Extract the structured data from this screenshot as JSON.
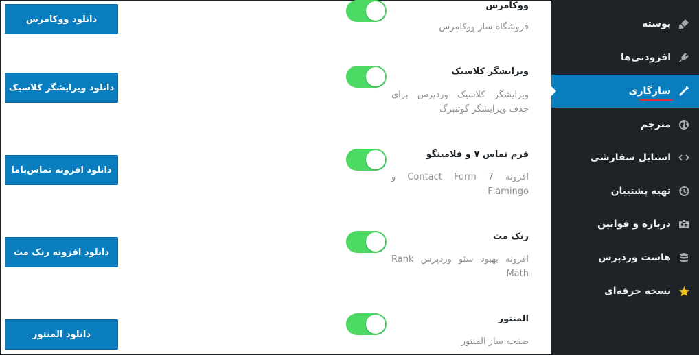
{
  "sidebar": {
    "items": [
      {
        "label": "پوسته",
        "icon": "brush-icon"
      },
      {
        "label": "افزودنی‌ها",
        "icon": "plugin-icon"
      },
      {
        "label": "سازگاری",
        "icon": "wrench-icon",
        "active": true
      },
      {
        "label": "مترجم",
        "icon": "globe-icon"
      },
      {
        "label": "استایل سفارشی",
        "icon": "code-icon"
      },
      {
        "label": "تهیه پشتیبان",
        "icon": "history-icon"
      },
      {
        "label": "درباره و قوانین",
        "icon": "id-card-icon"
      },
      {
        "label": "هاست وردپرس",
        "icon": "database-icon"
      },
      {
        "label": "نسخه حرفه‌ای",
        "icon": "star-icon"
      }
    ],
    "colors": {
      "background": "#1d2327",
      "active": "#0a7dbf",
      "underline": "#d63638",
      "star": "#f0c419"
    }
  },
  "plugins": [
    {
      "title": "ووکامرس",
      "description": "فروشگاه ساز ووکامرس",
      "enabled": true,
      "button": "دانلود ووکامرس"
    },
    {
      "title": "ویرایشگر کلاسیک",
      "description": "ویرایشگر کلاسیک وردپرس برای حذف ویرایشگر گوتنبرگ",
      "enabled": true,
      "button": "دانلود ویرایشگر کلاسیک"
    },
    {
      "title": "فرم تماس ۷ و فلامینگو",
      "description": "افزونه Contact Form 7 و Flamingo",
      "enabled": true,
      "button": "دانلود افزونه تماس‌باما"
    },
    {
      "title": "رنک مث",
      "description": "افزونه بهبود سئو وردپرس Rank Math",
      "enabled": true,
      "button": "دانلود افزونه رنک مث"
    },
    {
      "title": "المنتور",
      "description": "صفحه ساز المنتور",
      "enabled": true,
      "button": "دانلود المنتور"
    }
  ],
  "colors": {
    "toggle_on": "#4cd964",
    "button": "#0a7dbf"
  }
}
